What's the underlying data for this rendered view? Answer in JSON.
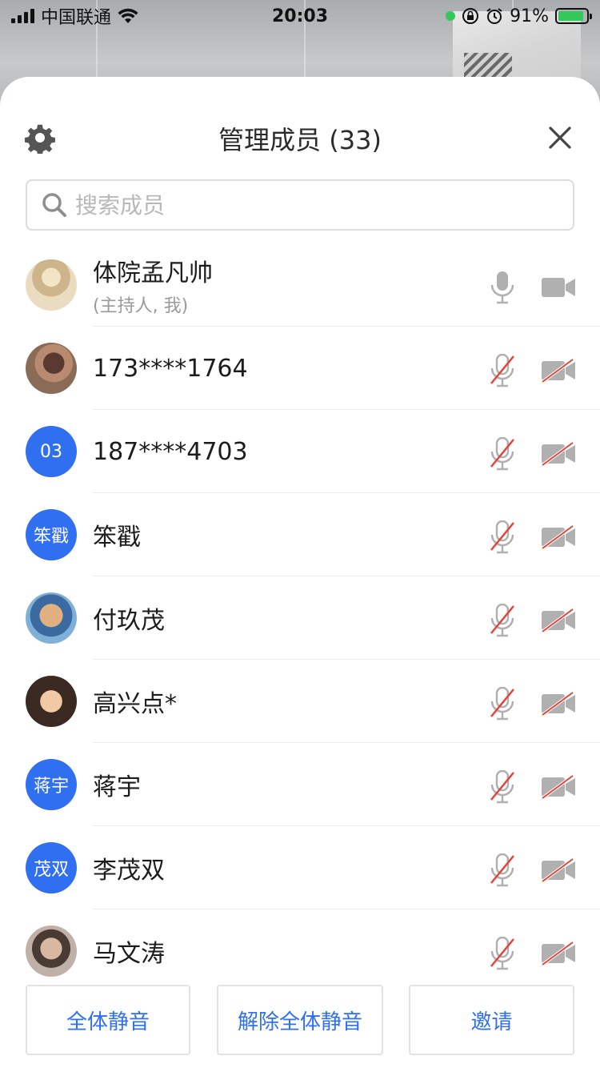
{
  "status_bar": {
    "carrier": "中国联通",
    "time": "20:03",
    "battery": "91%",
    "battery_level": 0.91,
    "icons": [
      "signal-icon",
      "wifi-icon",
      "camera-in-use-dot-icon",
      "rotation-lock-icon",
      "alarm-icon",
      "battery-charging-icon"
    ]
  },
  "colors": {
    "accent": "#2f6ff0",
    "muted_icon": "#b0b0b0",
    "slash_red": "#e0453c"
  },
  "sheet": {
    "title": "管理成员 (33)",
    "settings_icon": "gear-icon",
    "close_icon": "close-icon"
  },
  "search": {
    "placeholder": "搜索成员",
    "value": ""
  },
  "members": [
    {
      "name": "体院孟凡帅",
      "sub": "(主持人, 我)",
      "avatar_type": "photo",
      "avatar_text": "",
      "mic_muted": false,
      "cam_off": false
    },
    {
      "name": "173****1764",
      "sub": "",
      "avatar_type": "photo",
      "avatar_text": "",
      "mic_muted": true,
      "cam_off": true
    },
    {
      "name": "187****4703",
      "sub": "",
      "avatar_type": "initials",
      "avatar_text": "03",
      "mic_muted": true,
      "cam_off": true
    },
    {
      "name": "笨戳",
      "sub": "",
      "avatar_type": "initials",
      "avatar_text": "笨戳",
      "mic_muted": true,
      "cam_off": true
    },
    {
      "name": "付玖茂",
      "sub": "",
      "avatar_type": "photo",
      "avatar_text": "",
      "mic_muted": true,
      "cam_off": true
    },
    {
      "name": "高兴点*",
      "sub": "",
      "avatar_type": "photo",
      "avatar_text": "",
      "mic_muted": true,
      "cam_off": true
    },
    {
      "name": "蒋宇",
      "sub": "",
      "avatar_type": "initials",
      "avatar_text": "蒋宇",
      "mic_muted": true,
      "cam_off": true
    },
    {
      "name": "李茂双",
      "sub": "",
      "avatar_type": "initials",
      "avatar_text": "茂双",
      "mic_muted": true,
      "cam_off": true
    },
    {
      "name": "马文涛",
      "sub": "",
      "avatar_type": "photo",
      "avatar_text": "",
      "mic_muted": true,
      "cam_off": true
    }
  ],
  "footer": {
    "mute_all": "全体静音",
    "unmute_all": "解除全体静音",
    "invite": "邀请"
  }
}
